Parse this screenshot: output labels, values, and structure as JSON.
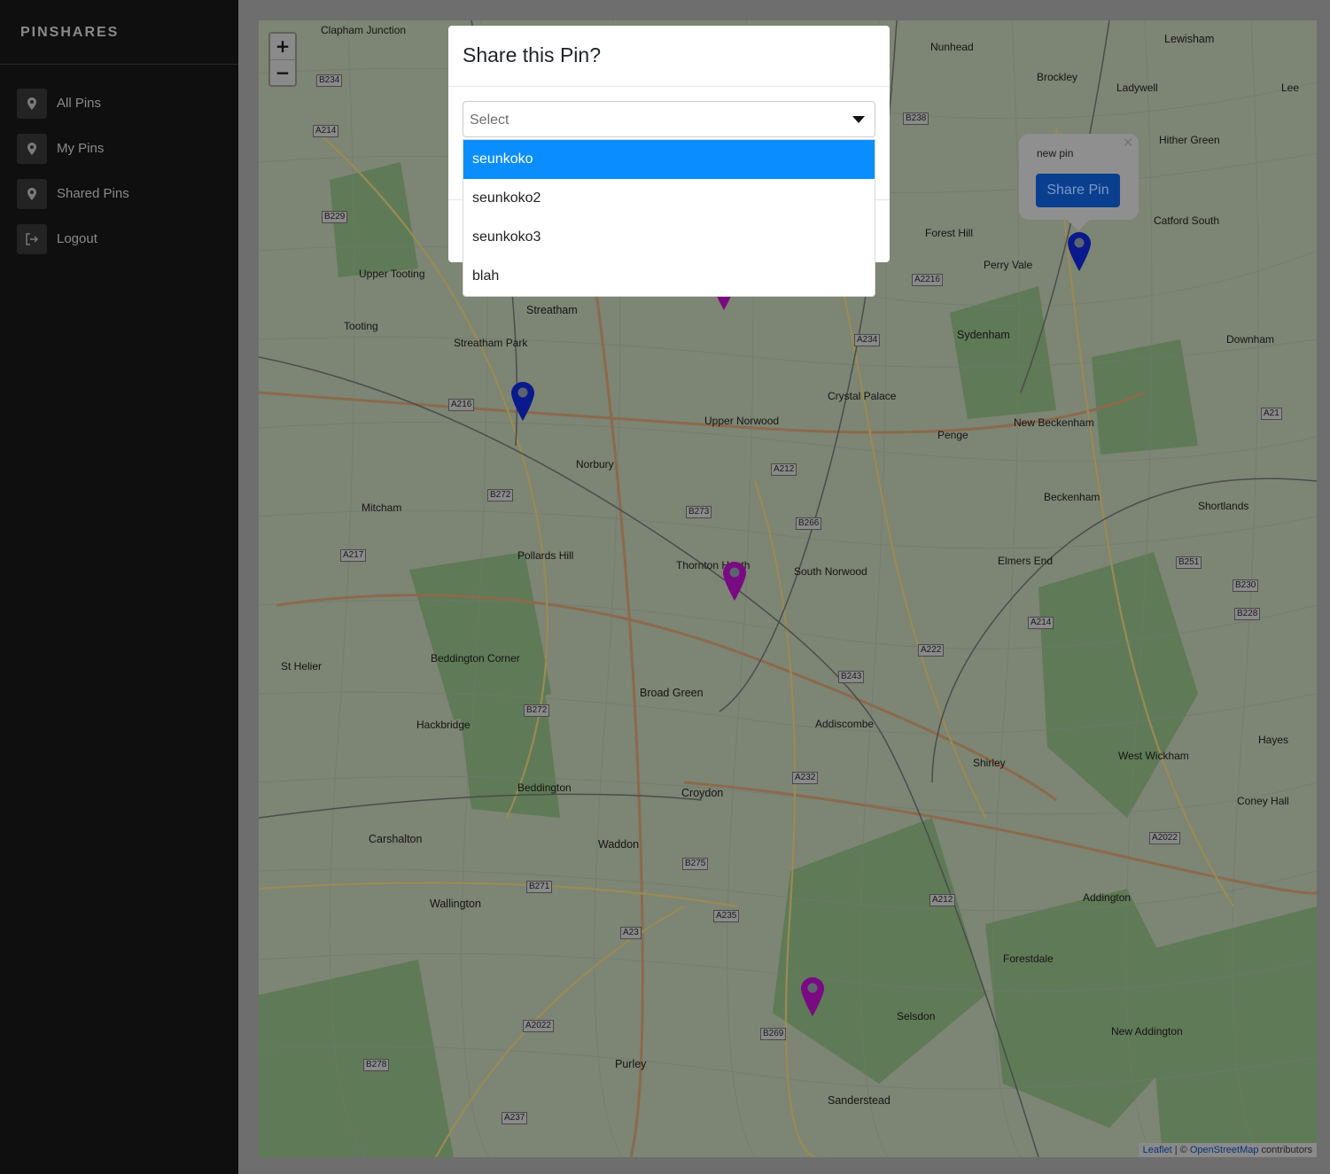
{
  "sidebar": {
    "brand": "PINSHARES",
    "items": [
      {
        "label": "All Pins",
        "icon": "map-pin-icon"
      },
      {
        "label": "My Pins",
        "icon": "map-pin-icon"
      },
      {
        "label": "Shared Pins",
        "icon": "map-pin-icon"
      },
      {
        "label": "Logout",
        "icon": "logout-icon"
      }
    ]
  },
  "map": {
    "zoom_in": "+",
    "zoom_out": "−",
    "places": [
      "Clapham Junction",
      "Nunhead",
      "Lewisham",
      "Brockley",
      "Ladywell",
      "Lee",
      "Hither Green",
      "Catford South",
      "Forest Hill",
      "Perry Vale",
      "Sydenham",
      "Downham",
      "Streatham",
      "Tooting",
      "Upper Tooting",
      "Streatham Park",
      "Upper Norwood",
      "Crystal Palace",
      "Penge",
      "New Beckenham",
      "Norbury",
      "Mitcham",
      "Beckenham",
      "Shortlands",
      "Pollards Hill",
      "Thornton Heath",
      "South Norwood",
      "Elmers End",
      "Broad Green",
      "Addiscombe",
      "Beddington Corner",
      "Hackbridge",
      "St Helier",
      "Beddington",
      "Croydon",
      "Shirley",
      "West Wickham",
      "Hayes",
      "Coney Hall",
      "Carshalton",
      "Waddon",
      "Wallington",
      "Addington",
      "Forestdale",
      "Selsdon",
      "New Addington",
      "Purley",
      "Sanderstead"
    ],
    "roads": [
      "B234",
      "A214",
      "B229",
      "B238",
      "A2216",
      "A234",
      "A216",
      "B272",
      "B273",
      "A212",
      "B266",
      "A217",
      "A23",
      "B251",
      "B230",
      "B228",
      "A214",
      "A222",
      "B243",
      "B272",
      "A232",
      "B275",
      "A2022",
      "B271",
      "A212",
      "A235",
      "A23",
      "A2022",
      "B269",
      "B278",
      "A237",
      "A21"
    ]
  },
  "popup": {
    "text": "new pin",
    "button": "Share Pin",
    "close": "×"
  },
  "attribution": {
    "leaflet": "Leaflet",
    "separator": " | © ",
    "osm": "OpenStreetMap",
    "suffix": " contributors"
  },
  "modal": {
    "title": "Share this Pin?",
    "select_placeholder": "Select",
    "options": [
      "seunkoko",
      "seunkoko2",
      "seunkoko3",
      "blah"
    ]
  },
  "colors": {
    "blue_pin": "#0a1a8c",
    "purple_pin": "#7a0a82",
    "option_highlight": "#0a8eff"
  }
}
